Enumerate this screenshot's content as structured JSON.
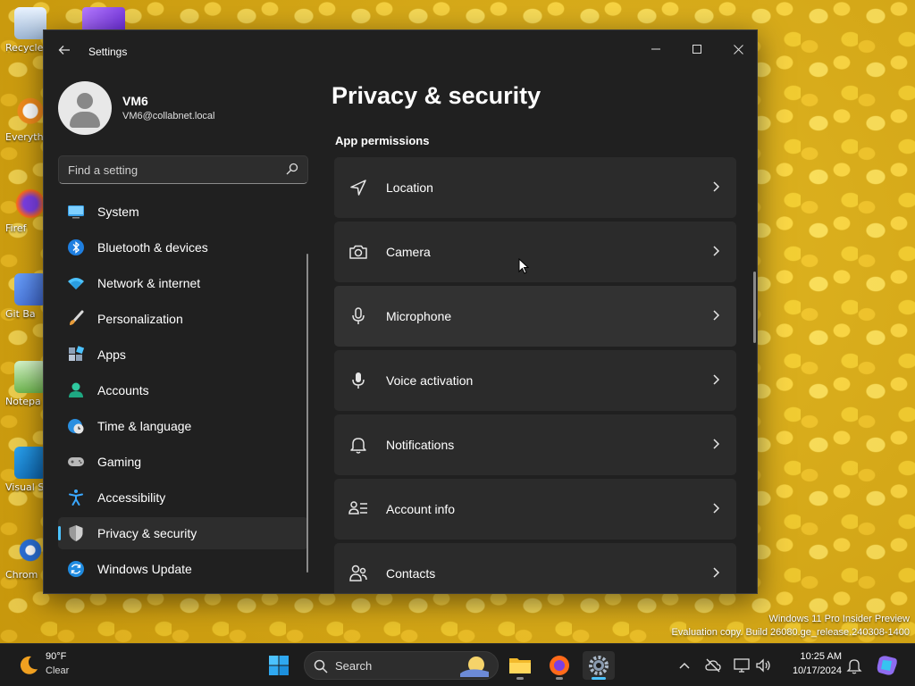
{
  "desktop": {
    "icons": [
      {
        "label": "Recycle"
      },
      {
        "label": "Everyth"
      },
      {
        "label": "Firef"
      },
      {
        "label": "Git Ba"
      },
      {
        "label": "Notepa"
      },
      {
        "label": "Visual St Cod"
      },
      {
        "label": "Chrom"
      }
    ]
  },
  "window": {
    "title": "Settings",
    "user": {
      "name": "VM6",
      "email": "VM6@collabnet.local"
    },
    "search": {
      "placeholder": "Find a setting"
    },
    "nav": [
      {
        "label": "System",
        "icon": "system-icon"
      },
      {
        "label": "Bluetooth & devices",
        "icon": "bluetooth-icon"
      },
      {
        "label": "Network & internet",
        "icon": "wifi-icon"
      },
      {
        "label": "Personalization",
        "icon": "brush-icon"
      },
      {
        "label": "Apps",
        "icon": "apps-icon"
      },
      {
        "label": "Accounts",
        "icon": "accounts-icon"
      },
      {
        "label": "Time & language",
        "icon": "globe-clock-icon"
      },
      {
        "label": "Gaming",
        "icon": "gamepad-icon"
      },
      {
        "label": "Accessibility",
        "icon": "accessibility-icon"
      },
      {
        "label": "Privacy & security",
        "icon": "shield-icon",
        "active": true
      },
      {
        "label": "Windows Update",
        "icon": "update-icon"
      }
    ],
    "page_title": "Privacy & security",
    "section_label": "App permissions",
    "permissions": [
      {
        "label": "Location",
        "icon": "location-arrow-icon"
      },
      {
        "label": "Camera",
        "icon": "camera-icon"
      },
      {
        "label": "Microphone",
        "icon": "microphone-icon"
      },
      {
        "label": "Voice activation",
        "icon": "voice-microphone-icon"
      },
      {
        "label": "Notifications",
        "icon": "bell-icon"
      },
      {
        "label": "Account info",
        "icon": "account-info-icon"
      },
      {
        "label": "Contacts",
        "icon": "contacts-icon"
      }
    ]
  },
  "watermark": {
    "line1": "Windows 11 Pro Insider Preview",
    "line2": "Evaluation copy. Build 26080.ge_release.240308-1400"
  },
  "taskbar": {
    "weather": {
      "temp": "90°F",
      "condition": "Clear"
    },
    "search_label": "Search",
    "clock": {
      "time": "10:25 AM",
      "date": "10/17/2024"
    }
  },
  "colors": {
    "accent": "#4cc2ff",
    "window_bg": "#202020",
    "card_bg": "#2b2b2b"
  }
}
